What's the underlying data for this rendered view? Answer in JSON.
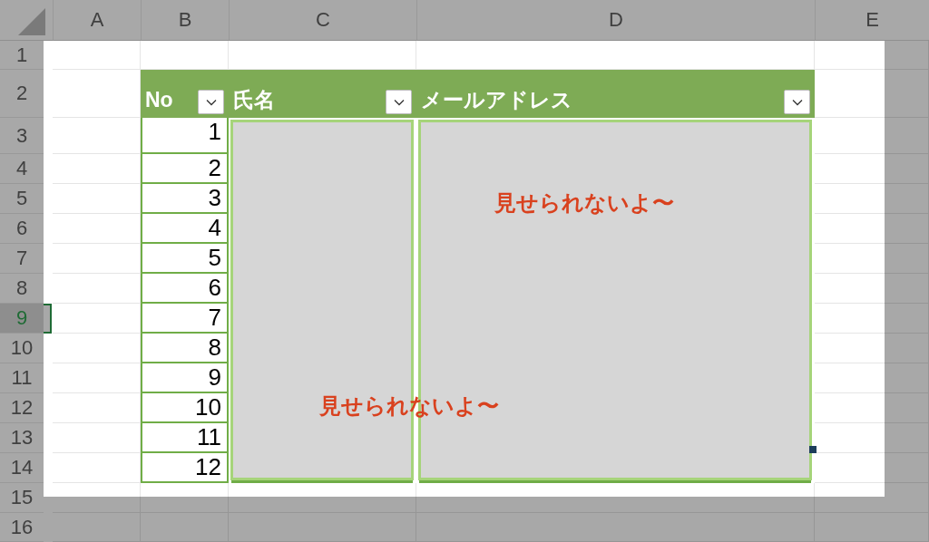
{
  "column_headers": [
    {
      "label": "A"
    },
    {
      "label": "B"
    },
    {
      "label": "C"
    },
    {
      "label": "D"
    },
    {
      "label": "E"
    }
  ],
  "row_headers": [
    {
      "label": "1",
      "selected": false
    },
    {
      "label": "2",
      "selected": false
    },
    {
      "label": "3",
      "selected": false
    },
    {
      "label": "4",
      "selected": false
    },
    {
      "label": "5",
      "selected": false
    },
    {
      "label": "6",
      "selected": false
    },
    {
      "label": "7",
      "selected": false
    },
    {
      "label": "8",
      "selected": false
    },
    {
      "label": "9",
      "selected": true
    },
    {
      "label": "10",
      "selected": false
    },
    {
      "label": "11",
      "selected": false
    },
    {
      "label": "12",
      "selected": false
    },
    {
      "label": "13",
      "selected": false
    },
    {
      "label": "14",
      "selected": false
    },
    {
      "label": "15",
      "selected": false
    },
    {
      "label": "16",
      "selected": false
    }
  ],
  "table": {
    "columns": [
      {
        "label": "No"
      },
      {
        "label": "氏名"
      },
      {
        "label": "メールアドレス"
      }
    ],
    "rows": [
      "1",
      "2",
      "3",
      "4",
      "5",
      "6",
      "7",
      "8",
      "9",
      "10",
      "11",
      "12"
    ]
  },
  "overlay_notes": [
    "見せられないよ〜",
    "見せられないよ〜"
  ]
}
